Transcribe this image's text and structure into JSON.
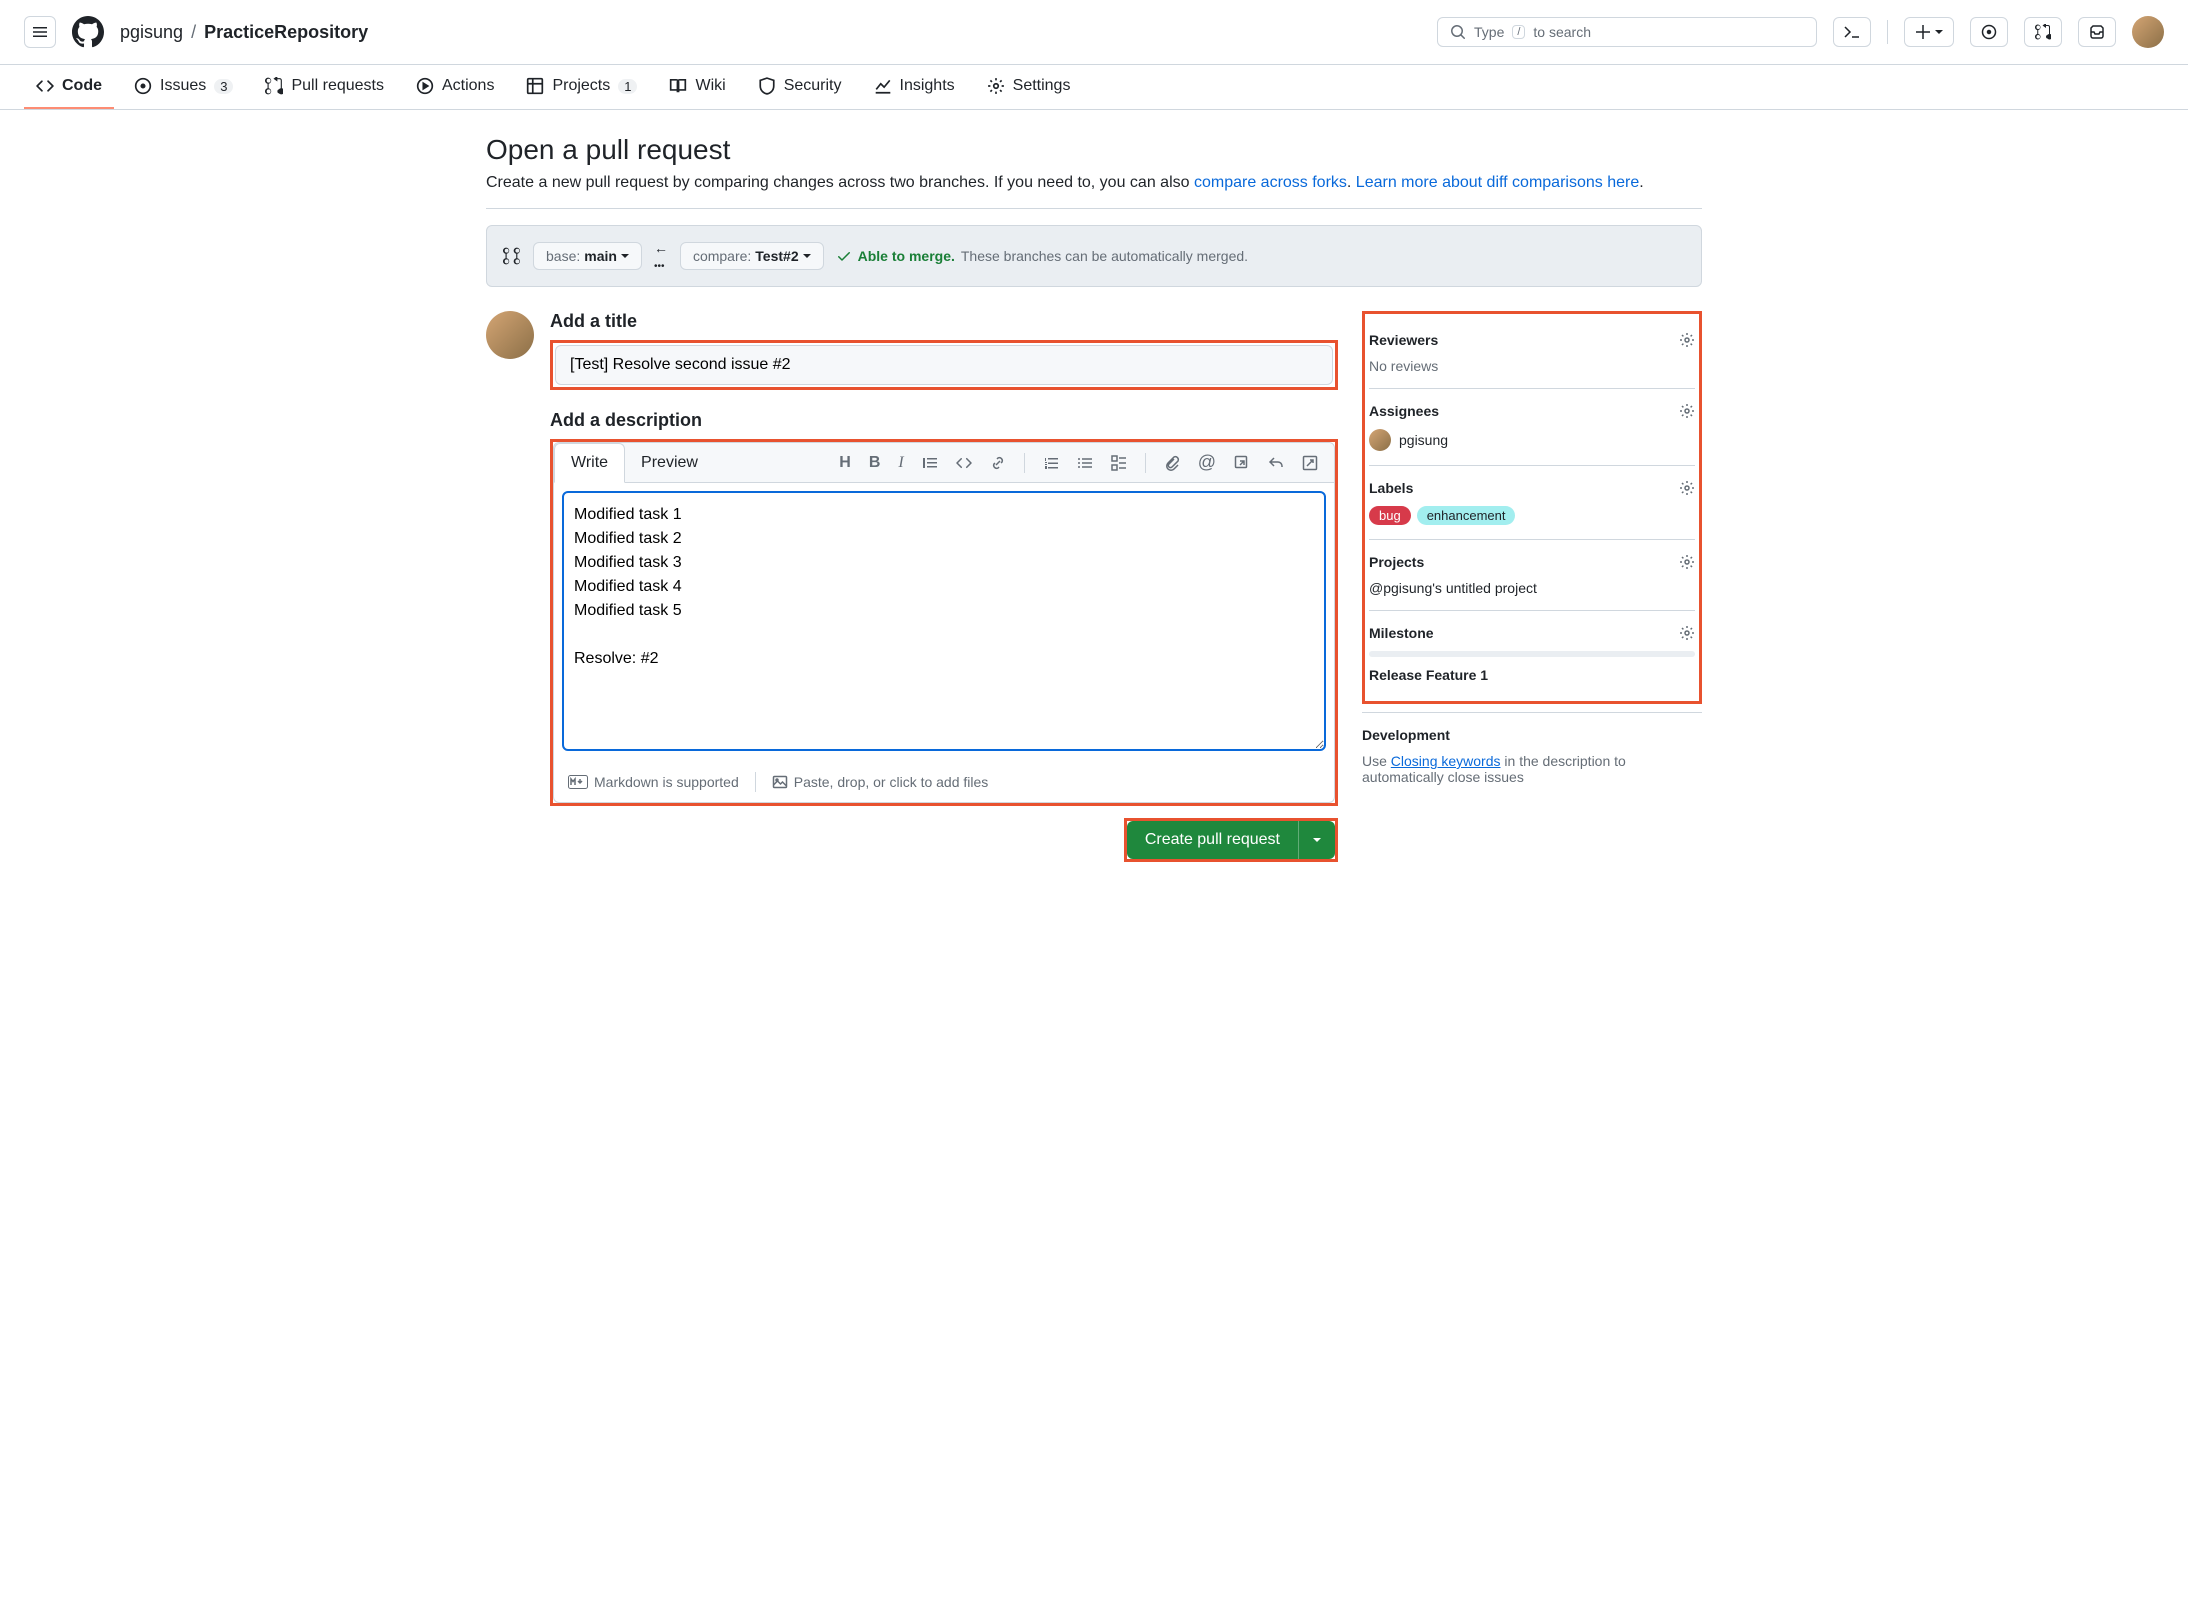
{
  "header": {
    "owner": "pgisung",
    "repo": "PracticeRepository",
    "search_placeholder": "Type",
    "search_hint2": "to search"
  },
  "nav": {
    "code": "Code",
    "issues": "Issues",
    "issues_count": "3",
    "pulls": "Pull requests",
    "actions": "Actions",
    "projects": "Projects",
    "projects_count": "1",
    "wiki": "Wiki",
    "security": "Security",
    "insights": "Insights",
    "settings": "Settings"
  },
  "page": {
    "title": "Open a pull request",
    "desc_pre": "Create a new pull request by comparing changes across two branches. If you need to, you can also ",
    "desc_link1": "compare across forks",
    "desc_mid": ". ",
    "desc_link2": "Learn more about diff comparisons here",
    "desc_post": "."
  },
  "compare": {
    "base_label": "base:",
    "base_val": "main",
    "compare_label": "compare:",
    "compare_val": "Test#2",
    "able": "Able to merge.",
    "msg": "These branches can be automatically merged."
  },
  "form": {
    "title_label": "Add a title",
    "title_value": "[Test] Resolve second issue #2",
    "desc_label": "Add a description",
    "tab_write": "Write",
    "tab_preview": "Preview",
    "desc_value": "Modified task 1\nModified task 2\nModified task 3\nModified task 4\nModified task 5\n\nResolve: #2",
    "md_supported": "Markdown is supported",
    "paste_hint": "Paste, drop, or click to add files",
    "create_btn": "Create pull request"
  },
  "sidebar": {
    "reviewers": {
      "title": "Reviewers",
      "body": "No reviews"
    },
    "assignees": {
      "title": "Assignees",
      "user": "pgisung"
    },
    "labels": {
      "title": "Labels",
      "bug": "bug",
      "enhancement": "enhancement"
    },
    "projects": {
      "title": "Projects",
      "body": "@pgisung's untitled project"
    },
    "milestone": {
      "title": "Milestone",
      "body": "Release Feature 1"
    },
    "development": {
      "title": "Development",
      "pre": "Use ",
      "link": "Closing keywords",
      "post": " in the description to automatically close issues"
    }
  }
}
